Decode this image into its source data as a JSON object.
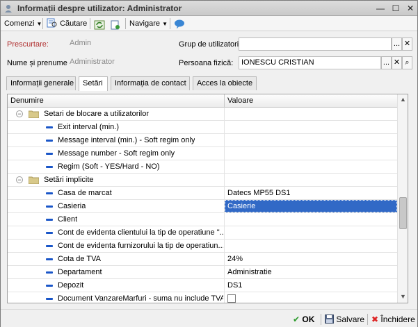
{
  "window": {
    "title": "Informații despre utilizator: Administrator",
    "controls": {
      "minimize": "—",
      "maximize": "☐",
      "close": "✕"
    }
  },
  "toolbar": {
    "comenzi_label": "Comenzi",
    "cautare_label": "Căutare",
    "navigare_label": "Navigare"
  },
  "form": {
    "prescurtare_label": "Prescurtare:",
    "prescurtare_value": "Admin",
    "nume_label": "Nume și prenume:",
    "nume_value": "Administrator",
    "grup_label": "Grup de utilizatori:",
    "grup_value": "",
    "persoana_label": "Persoana fizică:",
    "persoana_value": "IONESCU CRISTIAN",
    "ellipsis": "...",
    "clear": "✕",
    "search": "⌕"
  },
  "tabs": [
    {
      "label": "Informații generale",
      "active": false
    },
    {
      "label": "Setări",
      "active": true
    },
    {
      "label": "Informația de contact",
      "active": false
    },
    {
      "label": "Acces la obiecte",
      "active": false
    }
  ],
  "grid": {
    "col_name": "Denumire",
    "col_value": "Valoare",
    "rows": [
      {
        "kind": "group",
        "name": "Setari de blocare a utilizatorilor",
        "value": ""
      },
      {
        "kind": "item",
        "name": "Exit interval (min.)",
        "value": ""
      },
      {
        "kind": "item",
        "name": "Message interval (min.) - Soft regim only",
        "value": ""
      },
      {
        "kind": "item",
        "name": "Message number - Soft regim only",
        "value": ""
      },
      {
        "kind": "item",
        "name": "Regim (Soft - YES/Hard - NO)",
        "value": ""
      },
      {
        "kind": "group",
        "name": "Setări implicite",
        "value": ""
      },
      {
        "kind": "item",
        "name": "Casa de marcat",
        "value": "Datecs MP55 DS1"
      },
      {
        "kind": "item",
        "name": "Casieria",
        "value": "Casierie",
        "selected": true
      },
      {
        "kind": "item",
        "name": "Client",
        "value": ""
      },
      {
        "kind": "item",
        "name": "Cont de evidenta clientului la tip de operatiune \"...",
        "value": ""
      },
      {
        "kind": "item",
        "name": "Cont de evidenta furnizorului la tip de operatiun...",
        "value": ""
      },
      {
        "kind": "item",
        "name": "Cota de TVA",
        "value": "24%"
      },
      {
        "kind": "item",
        "name": "Departament",
        "value": "Administratie"
      },
      {
        "kind": "item",
        "name": "Depozit",
        "value": "DS1"
      },
      {
        "kind": "item",
        "name": "Document VanzareMarfuri - suma nu include TVA",
        "value": "",
        "checkbox": true
      }
    ]
  },
  "footer": {
    "ok_label": "OK",
    "save_label": "Salvare",
    "close_label": "Închidere"
  },
  "colors": {
    "selection": "#3169c6",
    "item_marker": "#1a56c8",
    "persoana_input_border": "#c0c0c0"
  }
}
